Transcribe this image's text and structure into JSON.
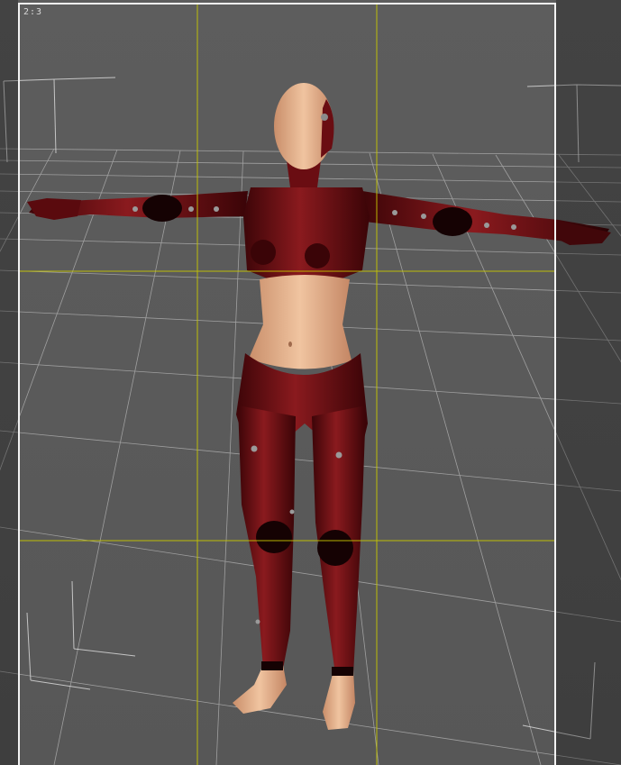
{
  "viewport": {
    "aspect_ratio_label": "2:3"
  },
  "colors": {
    "background": "#5a5a5a",
    "grid": "#bfbfbf",
    "guide": "#c8c800",
    "frame": "#f2f2f2",
    "suit": "#6a0d12",
    "skin": "#e6b48e"
  }
}
